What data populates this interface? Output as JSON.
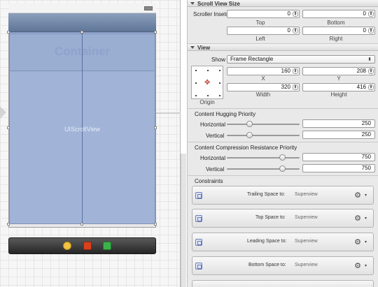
{
  "canvas": {
    "container_label": "Container",
    "scrollview_label": "UIScrollView"
  },
  "inspector": {
    "scroll_section": {
      "title": "Scroll View Size",
      "insets_label": "Scroller Insets",
      "top": {
        "value": "0",
        "caption": "Top"
      },
      "bottom": {
        "value": "0",
        "caption": "Bottom"
      },
      "left": {
        "value": "0",
        "caption": "Left"
      },
      "right": {
        "value": "0",
        "caption": "Right"
      }
    },
    "view_section": {
      "title": "View",
      "show_label": "Show",
      "show_value": "Frame Rectangle",
      "origin_caption": "Origin",
      "x": {
        "value": "160",
        "caption": "X"
      },
      "y": {
        "value": "208",
        "caption": "Y"
      },
      "width": {
        "value": "320",
        "caption": "Width"
      },
      "height": {
        "value": "416",
        "caption": "Height"
      }
    },
    "hugging": {
      "title": "Content Hugging Priority",
      "horizontal_label": "Horizontal",
      "vertical_label": "Vertical",
      "horizontal_value": "250",
      "vertical_value": "250",
      "horizontal_level": 0.32,
      "vertical_level": 0.32
    },
    "compression": {
      "title": "Content Compression Resistance Priority",
      "horizontal_label": "Horizontal",
      "vertical_label": "Vertical",
      "horizontal_value": "750",
      "vertical_value": "750",
      "horizontal_level": 0.77,
      "vertical_level": 0.77
    },
    "constraints": {
      "title": "Constraints",
      "items": [
        {
          "label": "Trailing Space to:",
          "target": "Superview"
        },
        {
          "label": "Top Space to:",
          "target": "Superview"
        },
        {
          "label": "Leading Space to:",
          "target": "Superview"
        },
        {
          "label": "Bottom Space to:",
          "target": "Superview"
        }
      ]
    }
  },
  "icons": {
    "stepper": "stepper-arrows",
    "gear": "gear-icon",
    "dock_first": "first-responder-icon",
    "dock_second": "exit-icon",
    "dock_third": "view-controller-icon"
  }
}
